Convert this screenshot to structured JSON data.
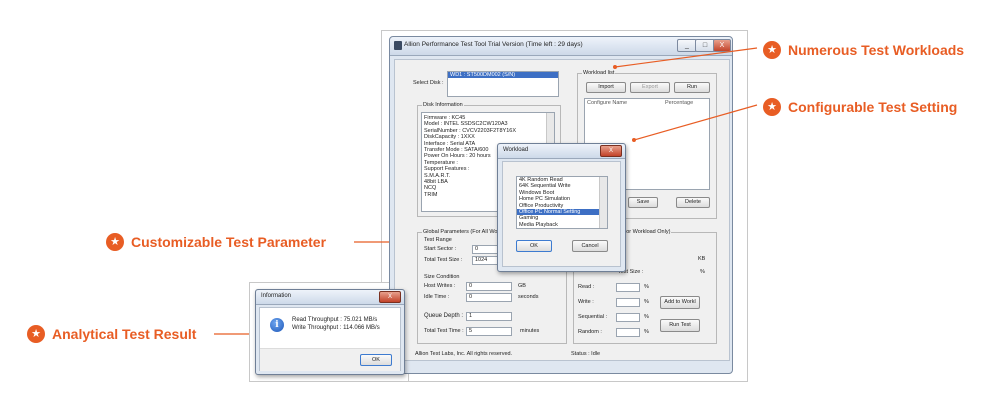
{
  "callouts": {
    "workloads": "Numerous Test Workloads",
    "setting": "Configurable Test Setting",
    "parameter": "Customizable Test Parameter",
    "result": "Analytical Test Result",
    "icon": "star-icon",
    "color": "#e85d24"
  },
  "main_window": {
    "title": "Allion Performance Test Tool Trial Version (Time left : 29 days)",
    "caption": {
      "minimize": "_",
      "maximize": "□",
      "close": "X"
    },
    "select_disk_label": "Select Disk :",
    "select_disk_value": "WD1 : ST500DM002 (S/N)",
    "disk_info_title": "Disk Information",
    "disk_info_lines": [
      "Firmware : KC45",
      "Model : INTEL SSDSC2CW120A3",
      "SerialNumber : CVCV2203F2T8Y16X",
      "DiskCapacity : 1XXX",
      "Interface : Serial ATA",
      "Transfer Mode : SATA/600",
      "Power On Hours : 20 hours",
      "Temperature :",
      "Support Features :",
      "S.M.A.R.T.",
      "48bit LBA",
      "NCQ",
      "TRIM"
    ],
    "workload_list_title": "Workload list",
    "btn_import": "Import",
    "btn_export": "Export",
    "btn_run": "Run",
    "col_configure_name": "Configure Name",
    "col_percentage": "Percentage",
    "btn_save": "Save",
    "btn_delete": "Delete",
    "global_params_title": "Global Parameters (For All Workload)",
    "test_range": "Test Range",
    "start_sector_label": "Start Sector :",
    "start_sector_value": "0",
    "total_test_size_label": "Total Test Size :",
    "total_test_size_value": "1024",
    "size_condition": "Size Condition",
    "host_writes_label": "Host Writes :",
    "host_writes_value": "0",
    "host_writes_unit": "GB",
    "idle_time_label": "Idle Time :",
    "idle_time_value": "0",
    "idle_time_unit": "seconds",
    "queue_depth_label": "Queue Depth :",
    "queue_depth_value": "1",
    "total_test_time_label": "Total Test Time :",
    "total_test_time_value": "5",
    "total_test_time_unit": "minutes",
    "workload_params_title": "(For Workload Only)",
    "kb_unit": "KB",
    "test_size_label": "Test Size :",
    "pct_unit": "%",
    "read_label": "Read :",
    "write_label": "Write :",
    "sequential_label": "Sequential :",
    "random_label": "Random :",
    "btn_add_to_workload": "Add to Workl",
    "btn_run_test": "Run Test",
    "footer_copyright": "Allion Test Labs, Inc. All rights reserved.",
    "status": "Status : Idle"
  },
  "workload_dialog": {
    "title": "Workload",
    "close": "X",
    "items": [
      "4K Random Read",
      "64K Sequential Write",
      "Windows Boot",
      "Home PC Simulation",
      "Office Productivity",
      "Office PC Normal Setting",
      "Gaming",
      "Media Playback"
    ],
    "selected_index": 5,
    "btn_ok": "OK",
    "btn_cancel": "Cancel"
  },
  "info_dialog": {
    "title": "Information",
    "close": "X",
    "line1": "Read Throughput : 75.021 MB/s",
    "line2": "Write Throughput : 114.066 MB/s",
    "btn_ok": "OK",
    "icon": "info-icon"
  }
}
